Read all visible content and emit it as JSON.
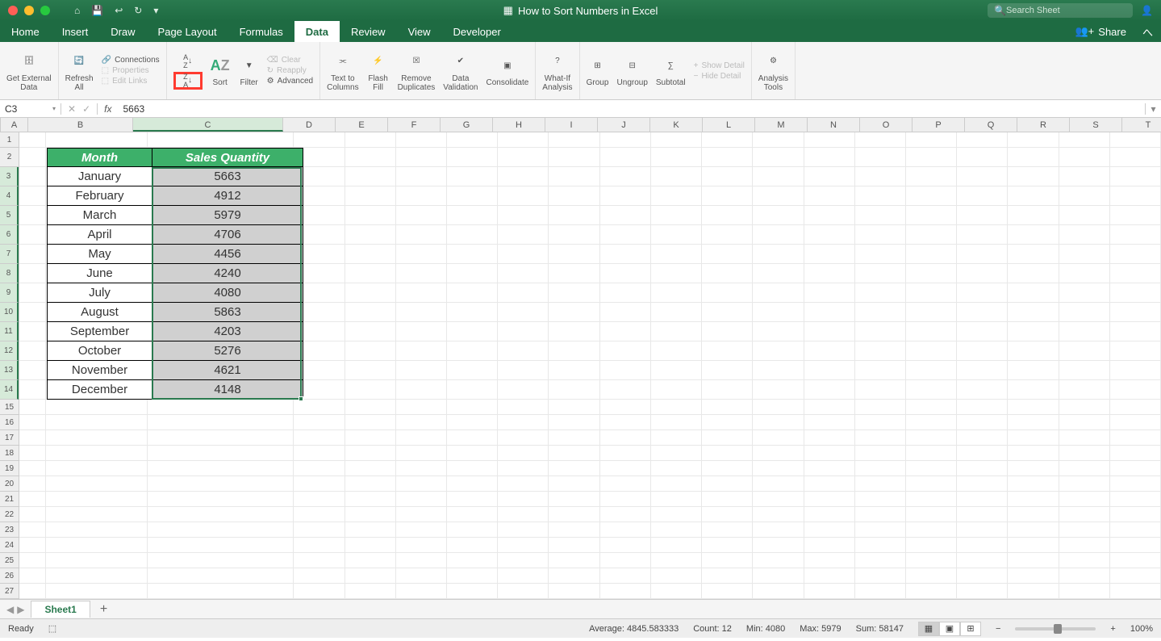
{
  "title": "How to Sort Numbers in Excel",
  "search_placeholder": "Search Sheet",
  "tabs": [
    "Home",
    "Insert",
    "Draw",
    "Page Layout",
    "Formulas",
    "Data",
    "Review",
    "View",
    "Developer"
  ],
  "active_tab": "Data",
  "share_label": "Share",
  "ribbon": {
    "get_external": "Get External\nData",
    "refresh": "Refresh\nAll",
    "connections": "Connections",
    "properties": "Properties",
    "edit_links": "Edit Links",
    "sort_asc": "A→Z↓",
    "sort_desc": "Z→A↓",
    "sort": "Sort",
    "filter": "Filter",
    "clear": "Clear",
    "reapply": "Reapply",
    "advanced": "Advanced",
    "text_cols": "Text to\nColumns",
    "flash": "Flash\nFill",
    "dup": "Remove\nDuplicates",
    "valid": "Data\nValidation",
    "consol": "Consolidate",
    "whatif": "What-If\nAnalysis",
    "group": "Group",
    "ungroup": "Ungroup",
    "subtotal": "Subtotal",
    "showd": "Show Detail",
    "hided": "Hide Detail",
    "atools": "Analysis\nTools"
  },
  "namebox": "C3",
  "formula_value": "5663",
  "columns": [
    "A",
    "B",
    "C",
    "D",
    "E",
    "F",
    "G",
    "H",
    "I",
    "J",
    "K",
    "L",
    "M",
    "N",
    "O",
    "P",
    "Q",
    "R",
    "S",
    "T"
  ],
  "rows_visible": 30,
  "table": {
    "headers": [
      "Month",
      "Sales Quantity"
    ],
    "rows": [
      [
        "January",
        "5663"
      ],
      [
        "February",
        "4912"
      ],
      [
        "March",
        "5979"
      ],
      [
        "April",
        "4706"
      ],
      [
        "May",
        "4456"
      ],
      [
        "June",
        "4240"
      ],
      [
        "July",
        "4080"
      ],
      [
        "August",
        "5863"
      ],
      [
        "September",
        "4203"
      ],
      [
        "October",
        "5276"
      ],
      [
        "November",
        "4621"
      ],
      [
        "December",
        "4148"
      ]
    ]
  },
  "sheet_name": "Sheet1",
  "status": {
    "ready": "Ready",
    "avg_label": "Average:",
    "avg": "4845.583333",
    "count_label": "Count:",
    "count": "12",
    "min_label": "Min:",
    "min": "4080",
    "max_label": "Max:",
    "max": "5979",
    "sum_label": "Sum:",
    "sum": "58147",
    "zoom": "100%"
  }
}
